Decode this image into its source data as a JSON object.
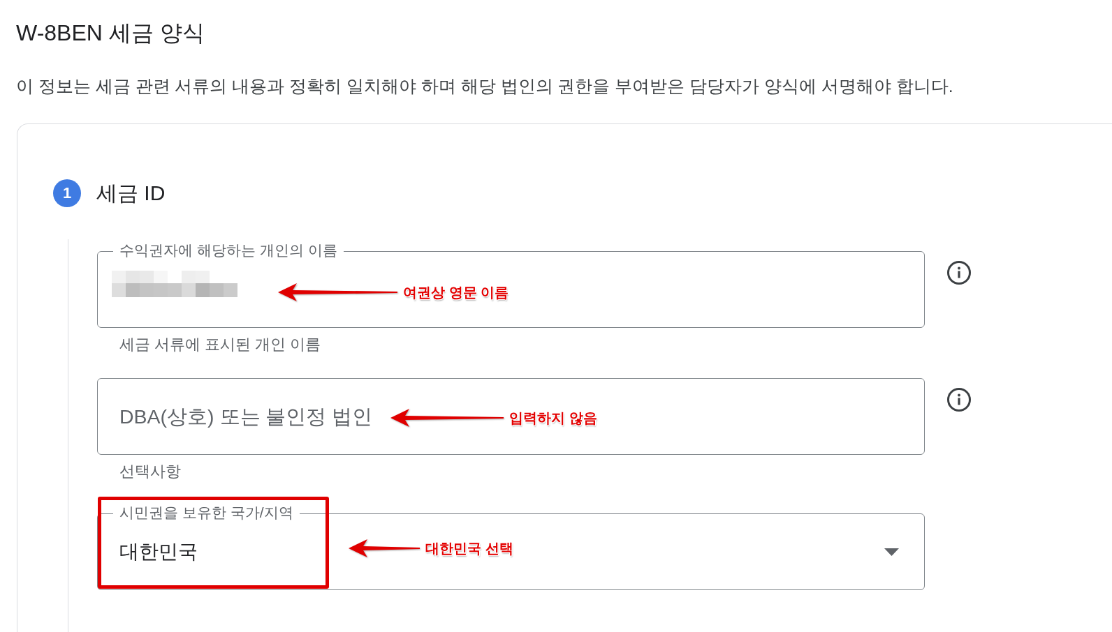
{
  "form": {
    "title": "W-8BEN 세금 양식",
    "description": "이 정보는 세금 관련 서류의 내용과 정확히 일치해야 하며 해당 법인의 권한을 부여받은 담당자가 양식에 서명해야 합니다."
  },
  "section": {
    "step": "1",
    "title": "세금 ID",
    "fields": [
      {
        "kind": "text",
        "label": "수익권자에 해당하는 개인의 이름",
        "redacted": true,
        "helper": "세금 서류에 표시된 개인 이름",
        "info": true,
        "annotation": "여권상 영문 이름",
        "highlighted": false
      },
      {
        "kind": "text",
        "placeholder": "DBA(상호) 또는 불인정 법인",
        "helper": "선택사항",
        "info": true,
        "annotation": "입력하지 않음",
        "highlighted": false
      },
      {
        "kind": "select",
        "label": "시민권을 보유한 국가/지역",
        "value": "대한민국",
        "info": false,
        "annotation": "대한민국 선택",
        "highlighted": true
      }
    ]
  }
}
